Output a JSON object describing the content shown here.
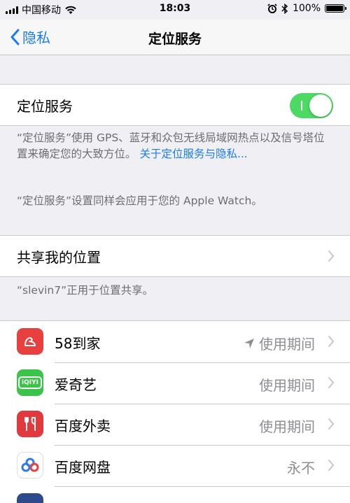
{
  "status_bar": {
    "carrier": "中国移动",
    "time": "18:03",
    "battery": "100%"
  },
  "nav": {
    "back_label": "隐私",
    "title": "定位服务"
  },
  "location_services": {
    "label": "定位服务",
    "enabled": true,
    "description": "“定位服务”使用 GPS、蓝牙和众包无线局域网热点以及信号塔位置来确定您的大致方位。",
    "link": "关于定位服务与隐私...",
    "watch_note": "“定位服务”设置同样会应用于您的 Apple Watch。"
  },
  "share_location": {
    "label": "共享我的位置",
    "note": "“slevin7”正用于位置共享。"
  },
  "apps": [
    {
      "name": "58到家",
      "status": "使用期间",
      "location_arrow": true,
      "icon": "58-daojia-icon",
      "color": "#e8403f"
    },
    {
      "name": "爱奇艺",
      "status": "使用期间",
      "location_arrow": false,
      "icon": "iqiyi-icon",
      "color": "#3bc34a"
    },
    {
      "name": "百度外卖",
      "status": "使用期间",
      "location_arrow": false,
      "icon": "baidu-waimai-icon",
      "color": "#e03a3e"
    },
    {
      "name": "百度网盘",
      "status": "永不",
      "location_arrow": false,
      "icon": "baidu-netdisk-icon",
      "color": "#ffffff"
    }
  ],
  "colors": {
    "accent": "#1a7cf5",
    "toggle_on": "#4cd964",
    "background": "#efeff4"
  }
}
